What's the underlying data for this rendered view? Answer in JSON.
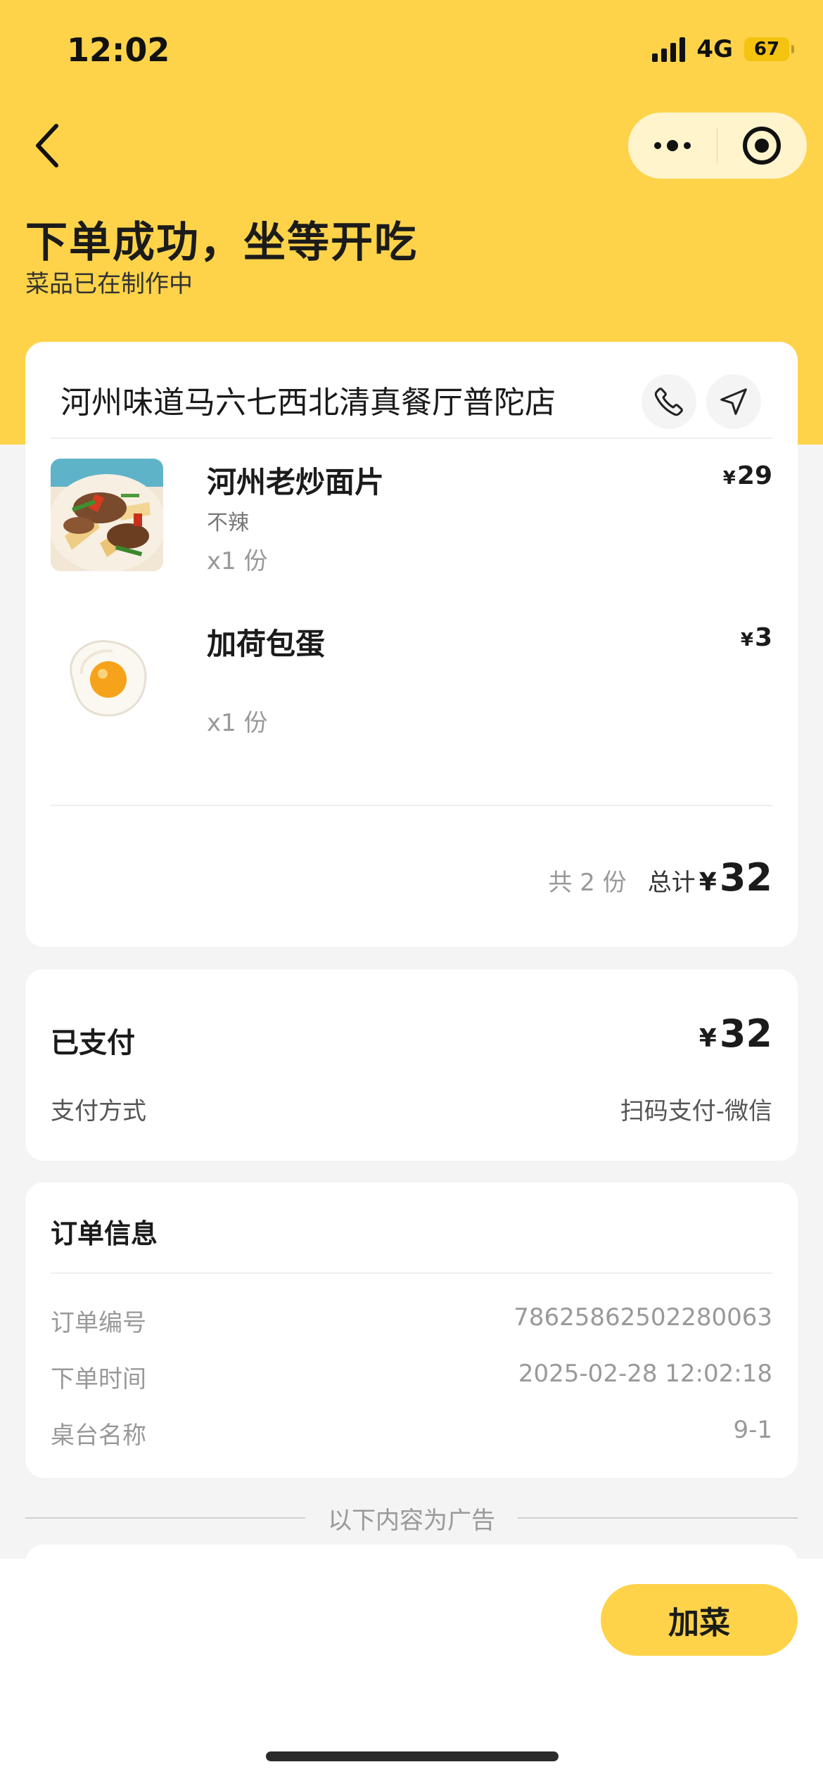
{
  "status_bar": {
    "time": "12:02",
    "network": "4G",
    "battery": "67"
  },
  "header": {
    "title": "下单成功，坐等开吃",
    "subtitle": "菜品已在制作中"
  },
  "store": {
    "name": "河州味道马六七西北清真餐厅普陀店",
    "phone_icon": "phone-icon",
    "navigate_icon": "navigation-arrow-icon"
  },
  "dishes": [
    {
      "name": "河州老炒面片",
      "spec": "不辣",
      "qty": "x1 份",
      "currency": "¥",
      "price": "29"
    },
    {
      "name": "加荷包蛋",
      "spec": "",
      "qty": "x1 份",
      "currency": "¥",
      "price": "3"
    }
  ],
  "summary": {
    "count": "共 2 份",
    "label": "总计",
    "currency": "¥",
    "total": "32"
  },
  "payment": {
    "title": "已支付",
    "currency": "¥",
    "amount": "32",
    "method_label": "支付方式",
    "method_value": "扫码支付-微信"
  },
  "order_info": {
    "title": "订单信息",
    "rows": [
      {
        "label": "订单编号",
        "value": "7862586250228006​3"
      },
      {
        "label": "下单时间",
        "value": "2025-02-28 12:02:18"
      },
      {
        "label": "桌台名称",
        "value": "9-1"
      }
    ]
  },
  "ad_divider": "以下内容为广告",
  "bottom": {
    "add_button": "加菜"
  },
  "colors": {
    "brand_yellow": "#fed349",
    "background": "#f4f4f4"
  }
}
